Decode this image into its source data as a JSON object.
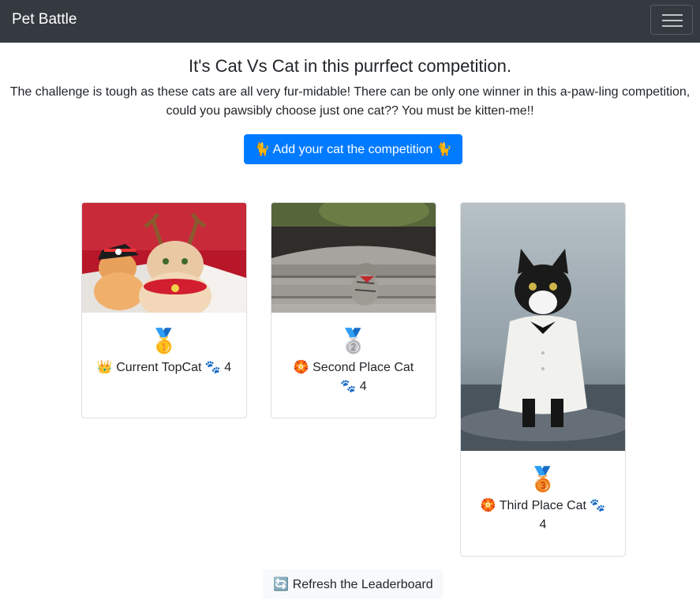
{
  "navbar": {
    "brand": "Pet Battle",
    "toggler_icon": "hamburger-menu-icon"
  },
  "hero": {
    "headline": "It's Cat Vs Cat in this purrfect competition.",
    "lead": "The challenge is tough as these cats are all very fur-midable! There can be only one winner in this a-paw-ling competition, could you pawsibly choose just one cat?? You must be kitten-me!!",
    "add_button_label": "🐈 Add your cat the competition 🐈"
  },
  "leaderboard": [
    {
      "medal": "🥇",
      "medal_icon": "gold-medal-icon",
      "label": "👑 Current TopCat 🐾 4",
      "photo_alt": "Cat wearing reindeer antlers with a kitten in a pirate hat"
    },
    {
      "medal": "🥈",
      "medal_icon": "silver-medal-icon",
      "label": "🏵️ Second Place Cat 🐾 4",
      "photo_alt": "Tabby cat sitting on stone steps wearing a red bow tie"
    },
    {
      "medal": "🥉",
      "medal_icon": "bronze-medal-icon",
      "label": "🏵️ Third Place Cat 🐾 4",
      "photo_alt": "Tuxedo cat wearing a white shirt and bow tie"
    }
  ],
  "refresh_button_label": "🔄 Refresh the Leaderboard",
  "colors": {
    "navbar_bg": "#343a40",
    "primary": "#007bff",
    "light_button": "#f8f9fa"
  }
}
